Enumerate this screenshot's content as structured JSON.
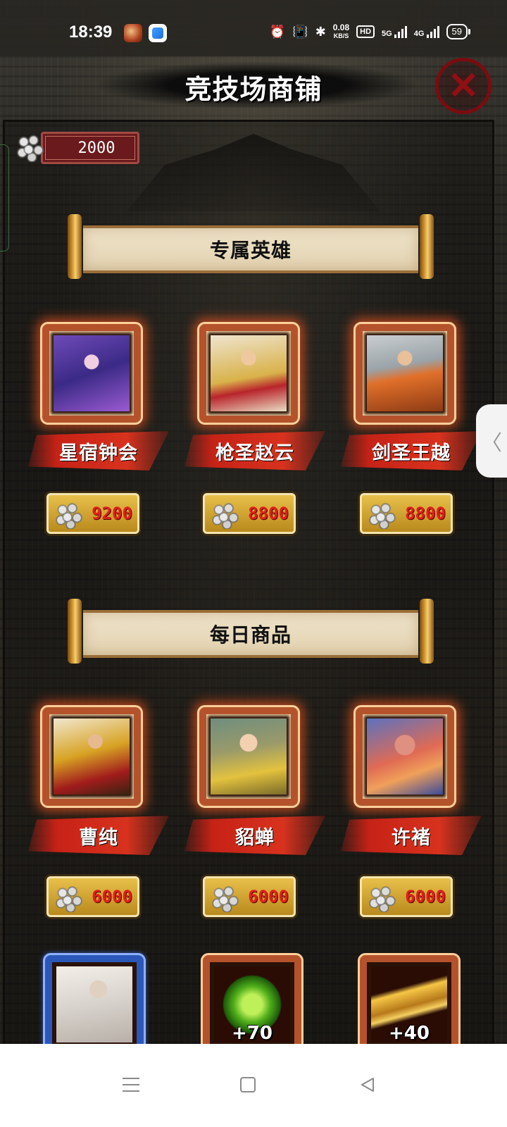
{
  "status_bar": {
    "time": "18:39",
    "net_speed_value": "0.08",
    "net_speed_unit": "KB/S",
    "hd_badge": "HD",
    "signal_1_label": "5G",
    "signal_2_label": "4G",
    "battery_level": "59"
  },
  "header": {
    "title": "竞技场商铺"
  },
  "currency": {
    "amount": "2000"
  },
  "sections": {
    "exclusive_heroes": {
      "title": "专属英雄",
      "items": [
        {
          "name": "星宿钟会",
          "price": "9200"
        },
        {
          "name": "枪圣赵云",
          "price": "8800"
        },
        {
          "name": "剑圣王越",
          "price": "8800"
        }
      ]
    },
    "daily_goods": {
      "title": "每日商品",
      "items": [
        {
          "name": "曹纯",
          "price": "6000"
        },
        {
          "name": "貂蝉",
          "price": "6000"
        },
        {
          "name": "许褚",
          "price": "6000"
        }
      ],
      "extra_items": [
        {
          "qty": ""
        },
        {
          "qty": "+70"
        },
        {
          "qty": "+40"
        }
      ]
    }
  },
  "icons": {
    "close": "close-icon",
    "coin": "coin-pile-icon",
    "side_tab": "chevron-left-icon",
    "nav_menu": "menu-icon",
    "nav_home": "home-icon",
    "nav_back": "back-icon"
  },
  "colors": {
    "price_text": "#e1201a",
    "ribbon": "#c62216",
    "card_frame": "#b4532b",
    "card_glow": "#ff5a1e"
  }
}
